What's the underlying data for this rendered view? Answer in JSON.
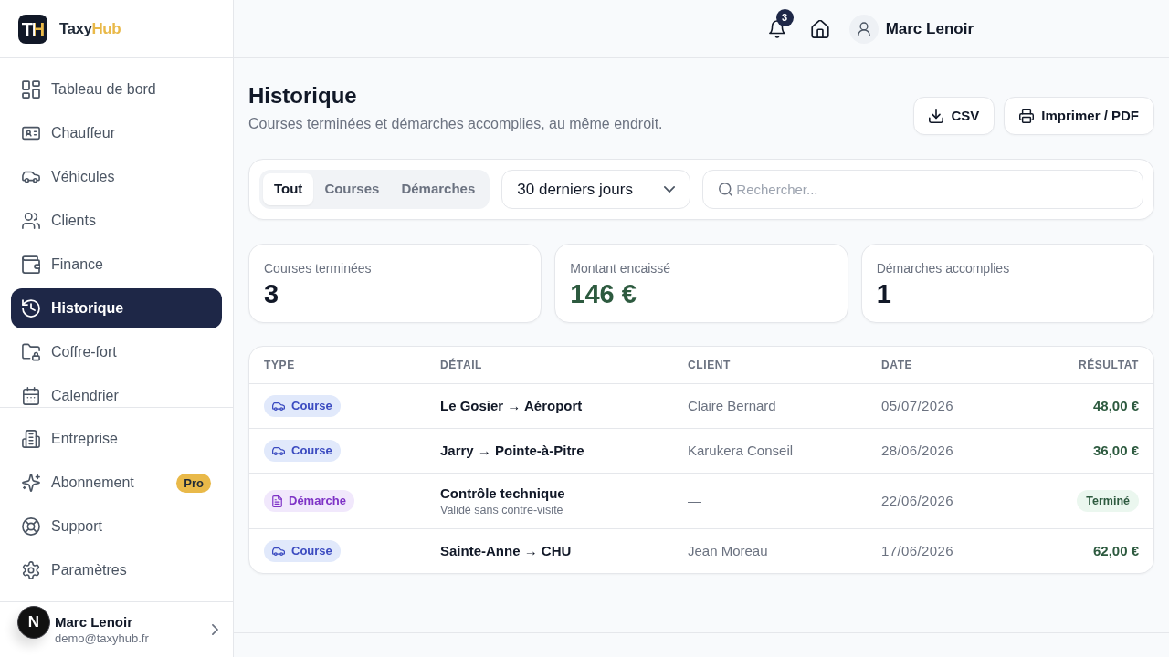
{
  "sidebar": {
    "brand": {
      "mark": "TH",
      "name": "Taxy",
      "name_accent": "Hub"
    },
    "nav": [
      {
        "label": "Tableau de bord",
        "selected": false
      },
      {
        "label": "Chauffeur",
        "selected": false
      },
      {
        "label": "Véhicules",
        "selected": false
      },
      {
        "label": "Clients",
        "selected": false
      },
      {
        "label": "Finance",
        "selected": false
      },
      {
        "label": "Historique",
        "selected": true
      },
      {
        "label": "Coffre-fort",
        "selected": false
      },
      {
        "label": "Calendrier",
        "selected": false
      }
    ],
    "nav_secondary": [
      {
        "label": "Entreprise",
        "selected": false
      },
      {
        "label": "Abonnement",
        "selected": false,
        "badge": "Pro"
      },
      {
        "label": "Support",
        "selected": false
      },
      {
        "label": "Paramètres",
        "selected": false
      }
    ],
    "user": {
      "name": "Marc Lenoir",
      "email": "demo@taxyhub.fr"
    }
  },
  "dev_indicator": {
    "label": "N"
  },
  "header": {
    "notifications": {
      "count": "3"
    },
    "user": {
      "name": "Marc Lenoir"
    }
  },
  "page": {
    "title": "Historique",
    "subtitle": "Courses terminées et démarches accomplies, au même endroit.",
    "actions": [
      {
        "label": "CSV"
      },
      {
        "label": "Imprimer / PDF"
      }
    ]
  },
  "filters": {
    "segments": [
      {
        "label": "Tout",
        "selected": true
      },
      {
        "label": "Courses",
        "selected": false
      },
      {
        "label": "Démarches",
        "selected": false
      }
    ],
    "period": {
      "value": "30 derniers jours"
    },
    "search": {
      "placeholder": "Rechercher..."
    }
  },
  "stats": [
    {
      "label": "Courses terminées",
      "value": "3",
      "kind": "count"
    },
    {
      "label": "Montant encaissé",
      "value": "146 €",
      "kind": "amount"
    },
    {
      "label": "Démarches accomplies",
      "value": "1",
      "kind": "count"
    }
  ],
  "table": {
    "columns": [
      {
        "label": "TYPE"
      },
      {
        "label": "DÉTAIL"
      },
      {
        "label": "CLIENT"
      },
      {
        "label": "DATE"
      },
      {
        "label": "RÉSULTAT"
      }
    ],
    "rows": [
      {
        "type": {
          "label": "Course",
          "kind": "course"
        },
        "detail": "Le Gosier → Aéroport",
        "client": "Claire Bernard",
        "date": "05/07/2026",
        "result": {
          "label": "48,00 €",
          "kind": "amount"
        }
      },
      {
        "type": {
          "label": "Course",
          "kind": "course"
        },
        "detail": "Jarry → Pointe-à-Pitre",
        "client": "Karukera Conseil",
        "date": "28/06/2026",
        "result": {
          "label": "36,00 €",
          "kind": "amount"
        }
      },
      {
        "type": {
          "label": "Démarche",
          "kind": "demarche"
        },
        "detail": "Contrôle technique",
        "note": "Validé sans contre-visite",
        "client": "—",
        "date": "22/06/2026",
        "result": {
          "label": "Terminé",
          "kind": "status"
        }
      },
      {
        "type": {
          "label": "Course",
          "kind": "course"
        },
        "detail": "Sainte-Anne → CHU",
        "client": "Jean Moreau",
        "date": "17/06/2026",
        "result": {
          "label": "62,00 €",
          "kind": "amount"
        }
      }
    ]
  }
}
